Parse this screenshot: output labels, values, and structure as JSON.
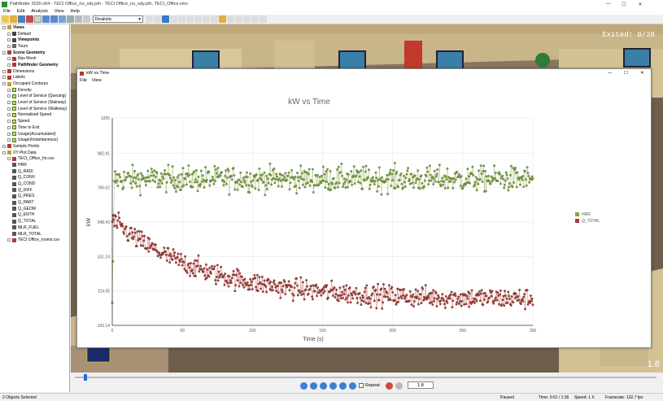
{
  "window": {
    "title": "Pathfinder 2020.x64 - TECI Office_no_sdy.pth - TECI Office_no_sdy.pth, TECI_Office.smv",
    "minimize": "—",
    "maximize": "☐",
    "close": "✕"
  },
  "menu": [
    "File",
    "Edit",
    "Analysis",
    "View",
    "Help"
  ],
  "toolbar": {
    "render_mode": "Realistic"
  },
  "tree": [
    {
      "label": "Views",
      "level": 0,
      "bold": true,
      "icon": "folder"
    },
    {
      "label": "Default",
      "level": 1,
      "bold": false,
      "icon": "view"
    },
    {
      "label": "Viewpoints",
      "level": 1,
      "bold": true,
      "icon": "view"
    },
    {
      "label": "Tours",
      "level": 1,
      "bold": false,
      "icon": "tour"
    },
    {
      "label": "Scene Geometry",
      "level": 0,
      "bold": true,
      "icon": "geom"
    },
    {
      "label": "Nav Mesh",
      "level": 1,
      "bold": false,
      "icon": "geom"
    },
    {
      "label": "Pathfinder Geometry",
      "level": 1,
      "bold": true,
      "icon": "geom"
    },
    {
      "label": "Dimensions",
      "level": 0,
      "bold": false,
      "icon": "geom"
    },
    {
      "label": "Labels",
      "level": 0,
      "bold": false,
      "icon": "geom"
    },
    {
      "label": "Occupant Contours",
      "level": 0,
      "bold": false,
      "icon": "folder"
    },
    {
      "label": "Density",
      "level": 1,
      "bold": false,
      "icon": "contour"
    },
    {
      "label": "Level of Service (Queuing)",
      "level": 1,
      "bold": false,
      "icon": "contour"
    },
    {
      "label": "Level of Service (Stairway)",
      "level": 1,
      "bold": false,
      "icon": "contour"
    },
    {
      "label": "Level of Service (Walkway)",
      "level": 1,
      "bold": false,
      "icon": "contour"
    },
    {
      "label": "Normalized Speed",
      "level": 1,
      "bold": false,
      "icon": "contour"
    },
    {
      "label": "Speed",
      "level": 1,
      "bold": false,
      "icon": "contour"
    },
    {
      "label": "Time to Exit",
      "level": 1,
      "bold": false,
      "icon": "contour"
    },
    {
      "label": "Usage(Accumulated)",
      "level": 1,
      "bold": false,
      "icon": "contour"
    },
    {
      "label": "Usage(Instantaneous)",
      "level": 1,
      "bold": false,
      "icon": "contour"
    },
    {
      "label": "Sample Points",
      "level": 0,
      "bold": false,
      "icon": "geom"
    },
    {
      "label": "XY Plot Data",
      "level": 0,
      "bold": false,
      "icon": "folder"
    },
    {
      "label": "TECI_Office_hrr.csv",
      "level": 1,
      "bold": false,
      "icon": "csv"
    },
    {
      "label": "HRR",
      "level": 2,
      "bold": false,
      "icon": "series"
    },
    {
      "label": "Q_RADI",
      "level": 2,
      "bold": false,
      "icon": "series"
    },
    {
      "label": "Q_CONV",
      "level": 2,
      "bold": false,
      "icon": "series"
    },
    {
      "label": "Q_COND",
      "level": 2,
      "bold": false,
      "icon": "series"
    },
    {
      "label": "Q_DIFF",
      "level": 2,
      "bold": false,
      "icon": "series"
    },
    {
      "label": "Q_PRES",
      "level": 2,
      "bold": false,
      "icon": "series"
    },
    {
      "label": "Q_PART",
      "level": 2,
      "bold": false,
      "icon": "series"
    },
    {
      "label": "Q_GEOM",
      "level": 2,
      "bold": false,
      "icon": "series"
    },
    {
      "label": "Q_ENTH",
      "level": 2,
      "bold": false,
      "icon": "series"
    },
    {
      "label": "Q_TOTAL",
      "level": 2,
      "bold": false,
      "icon": "series"
    },
    {
      "label": "MLR_FUEL",
      "level": 2,
      "bold": false,
      "icon": "series"
    },
    {
      "label": "MLR_TOTAL",
      "level": 2,
      "bold": false,
      "icon": "series"
    },
    {
      "label": "TECI Office_rooms.csv",
      "level": 1,
      "bold": false,
      "icon": "csv"
    }
  ],
  "viewport": {
    "exited_label": "Exited: 0/38",
    "time_overlay": "1.8"
  },
  "plot_window": {
    "title": "kW vs Time",
    "menu": [
      "File",
      "View"
    ]
  },
  "chart_data": {
    "type": "scatter",
    "title": "kW vs Time",
    "xlabel": "Time (s)",
    "ylabel": "kW",
    "xlim": [
      0,
      300
    ],
    "ylim": [
      -103.14,
      1205
    ],
    "x_ticks": [
      "0",
      "50",
      "100",
      "150",
      "200",
      "250",
      "300"
    ],
    "y_ticks": [
      "-103.14",
      "114.05",
      "331.24",
      "548.43",
      "765.62",
      "982.81",
      "1205"
    ],
    "legend_position": "right",
    "grid": true,
    "series": [
      {
        "name": "HRR",
        "color": "#7faa3a",
        "pattern": "noisy plateau",
        "mean": 820,
        "spread": 65,
        "x_range": [
          0,
          300
        ]
      },
      {
        "name": "Q_TOTAL",
        "color": "#b23a34",
        "pattern": "noisy decay",
        "start": 560,
        "end": 60,
        "spread": 55,
        "x_range": [
          0,
          300
        ]
      }
    ]
  },
  "playback": {
    "repeat_label": "Repeat",
    "time_value": "1.8"
  },
  "status": {
    "selection": "2 Objects Selected",
    "state": "Paused",
    "time": "Time: 0:01 / 1:36",
    "speed": "Speed: 1 X",
    "framerate": "Framerate: 132.7 fps"
  }
}
